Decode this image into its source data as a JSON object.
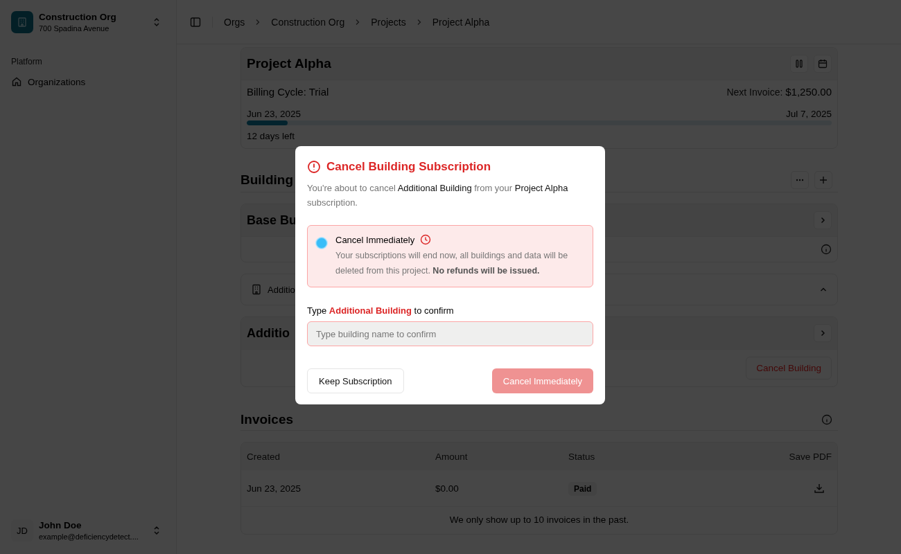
{
  "org": {
    "name": "Construction Org",
    "address": "700 Spadina Avenue"
  },
  "sidebar": {
    "section": "Platform",
    "items": [
      {
        "label": "Organizations"
      }
    ]
  },
  "user": {
    "initials": "JD",
    "name": "John Doe",
    "email": "example@deficiencydetect...."
  },
  "breadcrumbs": [
    "Orgs",
    "Construction Org",
    "Projects",
    "Project Alpha"
  ],
  "project": {
    "title": "Project Alpha",
    "billing_cycle": "Billing Cycle: Trial",
    "next_invoice_label": "Next Invoice:",
    "next_invoice_amount": "$1,250.00",
    "start_date": "Jun 23, 2025",
    "end_date": "Jul 7, 2025",
    "level": 0.07,
    "days_left": "12 days left"
  },
  "buildings": {
    "title": "Building",
    "items": [
      {
        "kind": "card",
        "title": "Base Bu"
      },
      {
        "kind": "row",
        "title": "Additio",
        "expanded": true
      },
      {
        "kind": "card",
        "title": "Additio",
        "action": "Cancel Building"
      }
    ]
  },
  "invoices": {
    "title": "Invoices",
    "columns": [
      "Created",
      "Amount",
      "Status",
      "Save PDF"
    ],
    "rows": [
      {
        "created": "Jun 23, 2025",
        "amount": "$0.00",
        "status": "Paid"
      }
    ],
    "note": "We only show up to 10 invoices in the past."
  },
  "dialog": {
    "title": "Cancel Building Subscription",
    "intro": [
      {
        "text": "You're about to cancel ",
        "emphasis": false
      },
      {
        "text": "Additional Building",
        "emphasis": true
      },
      {
        "text": " from your ",
        "emphasis": false
      },
      {
        "text": "Project Alpha",
        "emphasis": true
      },
      {
        "text": " subscription.",
        "emphasis": false
      }
    ],
    "option": {
      "label": "Cancel Immediately",
      "selected": true,
      "description": "Your subscriptions will end now, all buildings and data will be deleted from this project. **No refunds will be issued.**"
    },
    "prompt": [
      {
        "text": "Type ",
        "emphasis": false
      },
      {
        "text": "Additional Building",
        "emphasis": true
      },
      {
        "text": " to confirm",
        "emphasis": false
      }
    ],
    "placeholder": "Type building name to confirm",
    "keep_button": "Keep Subscription",
    "confirm_button": {
      "label": "Cancel Immediately",
      "disabled": true
    }
  }
}
